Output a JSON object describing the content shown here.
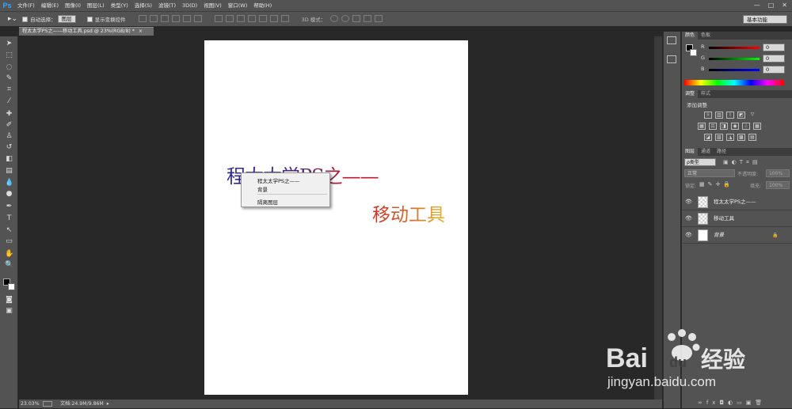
{
  "app": {
    "logo": "Ps"
  },
  "menubar": {
    "items": [
      "文件(F)",
      "编辑(E)",
      "图像(I)",
      "图层(L)",
      "类型(Y)",
      "选择(S)",
      "滤镜(T)",
      "3D(D)",
      "视图(V)",
      "窗口(W)",
      "帮助(H)"
    ],
    "minimize": "—",
    "maximize": "□",
    "close": "✕"
  },
  "options": {
    "auto_select_label": "自动选择：",
    "auto_select_value": "图层",
    "show_transform_label": "显示变换控件",
    "mode_3d_label": "3D 模式：",
    "workspace": "基本功能"
  },
  "document": {
    "tab_title": "程太太学PS之——移动工具.psd @ 23%(RGB/8) *",
    "tab_close": "×"
  },
  "canvas": {
    "title_text": "程太太学PS之——",
    "move_text": "移动工具"
  },
  "context_menu": {
    "items": [
      "程太太学PS之——",
      "背景",
      "隔离图层"
    ]
  },
  "status": {
    "zoom": "23.03%",
    "doc_info": "文档:24.9M/9.86M"
  },
  "color_panel": {
    "tabs": [
      "颜色",
      "色板"
    ],
    "channels": [
      {
        "label": "R",
        "value": "0",
        "color": "#d02020"
      },
      {
        "label": "G",
        "value": "0",
        "color": "#20b020"
      },
      {
        "label": "B",
        "value": "0",
        "color": "#2030d0"
      }
    ]
  },
  "adjust_panel": {
    "tabs": [
      "调整",
      "样式"
    ],
    "add_label": "添加调整"
  },
  "layers_panel": {
    "tabs": [
      "图层",
      "通道",
      "路径"
    ],
    "filter_label": "ρ类型",
    "blend_mode": "正常",
    "opacity_label": "不透明度:",
    "opacity_value": "100%",
    "lock_label": "锁定:",
    "fill_label": "填充:",
    "fill_value": "100%",
    "layers": [
      {
        "name": "程太太学PS之——"
      },
      {
        "name": "移动工具"
      },
      {
        "name": "背景"
      }
    ]
  },
  "watermark": {
    "brand": "Bai",
    "brand2": "du",
    "cn": "经验",
    "url": "jingyan.baidu.com"
  }
}
